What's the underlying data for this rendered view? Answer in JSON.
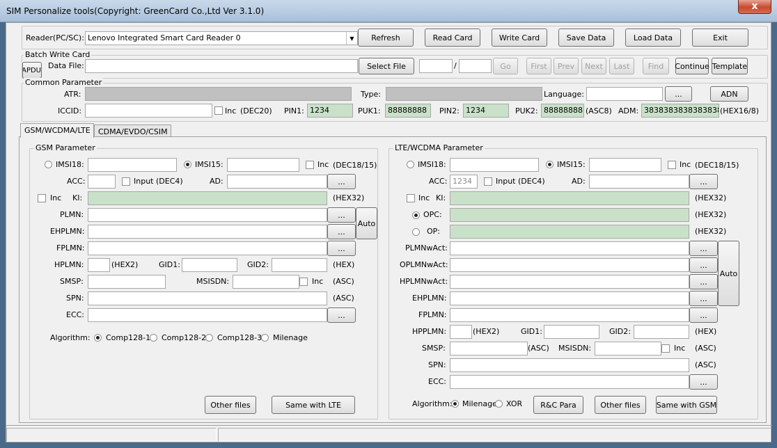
{
  "window": {
    "title": "SIM Personalize tools(Copyright: GreenCard Co.,Ltd Ver 3.1.0)",
    "close": "x"
  },
  "toolbar": {
    "reader_label": "Reader(PC/SC):",
    "reader_value": "Lenovo Integrated Smart Card Reader 0",
    "refresh": "Refresh",
    "read_card": "Read Card",
    "write_card": "Write Card",
    "save_data": "Save Data",
    "load_data": "Load Data",
    "exit": "Exit"
  },
  "batch": {
    "group": "Batch Write Card",
    "apdu": "APDU",
    "data_file_label": "Data File:",
    "select_file": "Select File",
    "slash": "/",
    "go": "Go",
    "first": "First",
    "prev": "Prev",
    "next": "Next",
    "last": "Last",
    "find": "Find",
    "continue": "Continue",
    "template": "Template"
  },
  "common": {
    "group": "Common Parameter",
    "atr_label": "ATR:",
    "type_label": "Type:",
    "language_label": "Language:",
    "dots": "...",
    "adn": "ADN",
    "iccid_label": "ICCID:",
    "inc": "Inc",
    "dec20": "(DEC20)",
    "pin1_label": "PIN1:",
    "pin1": "1234",
    "puk1_label": "PUK1:",
    "puk1": "88888888",
    "pin2_label": "PIN2:",
    "pin2": "1234",
    "puk2_label": "PUK2:",
    "puk2": "88888888",
    "asc8": "(ASC8)",
    "adm_label": "ADM:",
    "adm": "3838383838383838",
    "hex168": "(HEX16/8)"
  },
  "tabs": [
    "GSM/WCDMA/LTE",
    "CDMA/EVDO/CSIM"
  ],
  "gsm": {
    "group": "GSM Parameter",
    "imsi18": "IMSI18:",
    "imsi15": "IMSI15:",
    "inc": "Inc",
    "dec1815": "(DEC18/15)",
    "acc": "ACC:",
    "input_dec4": "Input (DEC4)",
    "ad": "AD:",
    "dots": "...",
    "ki": "KI:",
    "hex32": "(HEX32)",
    "plmn": "PLMN:",
    "ehplmn": "EHPLMN:",
    "auto": "Auto",
    "fplmn": "FPLMN:",
    "hplmn": "HPLMN:",
    "hex2": "(HEX2)",
    "gid1": "GID1:",
    "gid2": "GID2:",
    "hex": "(HEX)",
    "smsp": "SMSP:",
    "msisdn": "MSISDN:",
    "asc": "(ASC)",
    "spn": "SPN:",
    "ecc": "ECC:",
    "algorithm": "Algorithm:",
    "comp1": "Comp128-1",
    "comp2": "Comp128-2",
    "comp3": "Comp128-3",
    "milenage": "Milenage",
    "other_files": "Other files",
    "same_lte": "Same with LTE"
  },
  "lte": {
    "group": "LTE/WCDMA Parameter",
    "imsi18": "IMSI18:",
    "imsi15": "IMSI15:",
    "inc": "Inc",
    "dec1815": "(DEC18/15)",
    "acc": "ACC:",
    "acc_value": "1234",
    "input_dec4": "Input (DEC4)",
    "ad": "AD:",
    "dots": "...",
    "ki": "KI:",
    "hex32": "(HEX32)",
    "opc": "OPC:",
    "op": "OP:",
    "plmnwact": "PLMNwAct:",
    "oplmnwact": "OPLMNwAct:",
    "hplmnwact": "HPLMNwAct:",
    "auto": "Auto",
    "ehplmn": "EHPLMN:",
    "fplmn": "FPLMN:",
    "hpplmn": "HPPLMN:",
    "hex2": "(HEX2)",
    "gid1": "GID1:",
    "gid2": "GID2:",
    "hex": "(HEX)",
    "smsp": "SMSP:",
    "asc": "(ASC)",
    "msisdn": "MSISDN:",
    "spn": "SPN:",
    "ecc": "ECC:",
    "algorithm": "Algorithm:",
    "milenage": "Milenage",
    "xor": "XOR",
    "rc_para": "R&C Para",
    "other_files": "Other files",
    "same_gsm": "Same with GSM"
  }
}
